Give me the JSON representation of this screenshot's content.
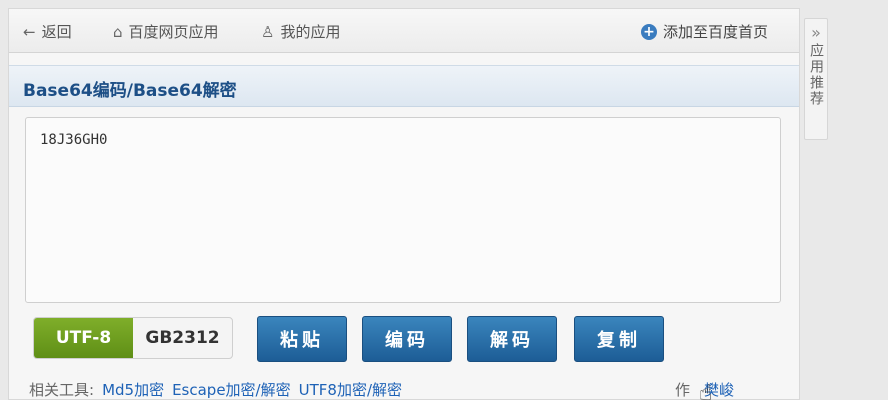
{
  "topbar": {
    "back_label": "返回",
    "apps_label": "百度网页应用",
    "my_apps_label": "我的应用",
    "add_home_label": "添加至百度首页"
  },
  "header": {
    "title": "Base64编码/Base64解密"
  },
  "editor": {
    "value": "18J36GH0"
  },
  "encoding": {
    "options": [
      "UTF-8",
      "GB2312"
    ],
    "selected": "UTF-8"
  },
  "actions": {
    "paste_label": "粘贴",
    "encode_label": "编码",
    "decode_label": "解码",
    "copy_label": "复制"
  },
  "footer": {
    "tools_label": "相关工具:",
    "tools": [
      "Md5加密",
      "Escape加密/解密",
      "UTF8加密/解密"
    ],
    "author_label": "作",
    "author_name": "樊峻"
  },
  "sidebar": {
    "recommend_label": "应用推荐"
  },
  "colors": {
    "accent_blue": "#1d5d96",
    "active_green": "#6c9c1e",
    "title_blue": "#1d4f86"
  }
}
